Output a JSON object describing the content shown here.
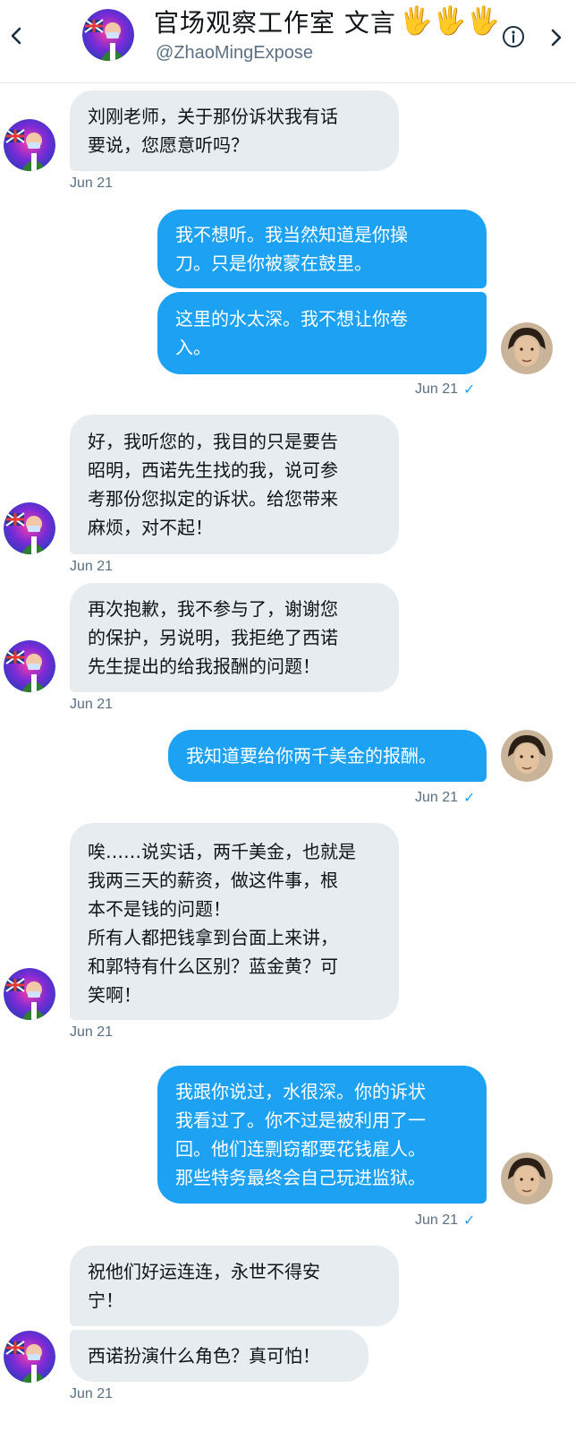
{
  "header": {
    "title": "官场观察工作室 文言",
    "title_emoji": "🖐🖐🖐",
    "handle": "@ZhaoMingExpose"
  },
  "colors": {
    "outgoing_bubble": "#1da1f2",
    "incoming_bubble": "#e6ecf0",
    "timestamp": "#5b7083",
    "read_check": "#1da1f2"
  },
  "icons": {
    "back": "chevron-left-icon",
    "info": "info-icon",
    "forward": "chevron-right-icon",
    "read": "checkmark-icon"
  },
  "messages": [
    {
      "dir": "in",
      "text": "刘刚老师，关于那份诉状我有话\n要说，您愿意听吗？",
      "time": "Jun 21"
    },
    {
      "dir": "out",
      "text": "我不想听。我当然知道是你操\n刀。只是你被蒙在鼓里。"
    },
    {
      "dir": "out",
      "text": "这里的水太深。我不想让你卷\n入。",
      "time": "Jun 21",
      "read": "✓"
    },
    {
      "dir": "in",
      "text": "好，我听您的，我目的只是要告\n昭明，西诺先生找的我，说可参\n考那份您拟定的诉状。给您带来\n麻烦，对不起！",
      "time": "Jun 21"
    },
    {
      "dir": "in",
      "text": "再次抱歉，我不参与了，谢谢您\n的保护，另说明，我拒绝了西诺\n先生提出的给我报酬的问题！",
      "time": "Jun 21"
    },
    {
      "dir": "out",
      "text": "我知道要给你两千美金的报酬。",
      "time": "Jun 21",
      "read": "✓"
    },
    {
      "dir": "in",
      "text": "唉……说实话，两千美金，也就是\n我两三天的薪资，做这件事，根\n本不是钱的问题！\n所有人都把钱拿到台面上来讲，\n和郭特有什么区别？蓝金黄？可\n笑啊！",
      "time": "Jun 21"
    },
    {
      "dir": "out",
      "text": "我跟你说过，水很深。你的诉状\n我看过了。你不过是被利用了一\n回。他们连剽窃都要花钱雇人。\n那些特务最终会自己玩进监狱。",
      "time": "Jun 21",
      "read": "✓"
    },
    {
      "dir": "in",
      "text": "祝他们好运连连，永世不得安\n宁！"
    },
    {
      "dir": "in",
      "text": "西诺扮演什么角色？真可怕！",
      "time": "Jun 21"
    }
  ]
}
